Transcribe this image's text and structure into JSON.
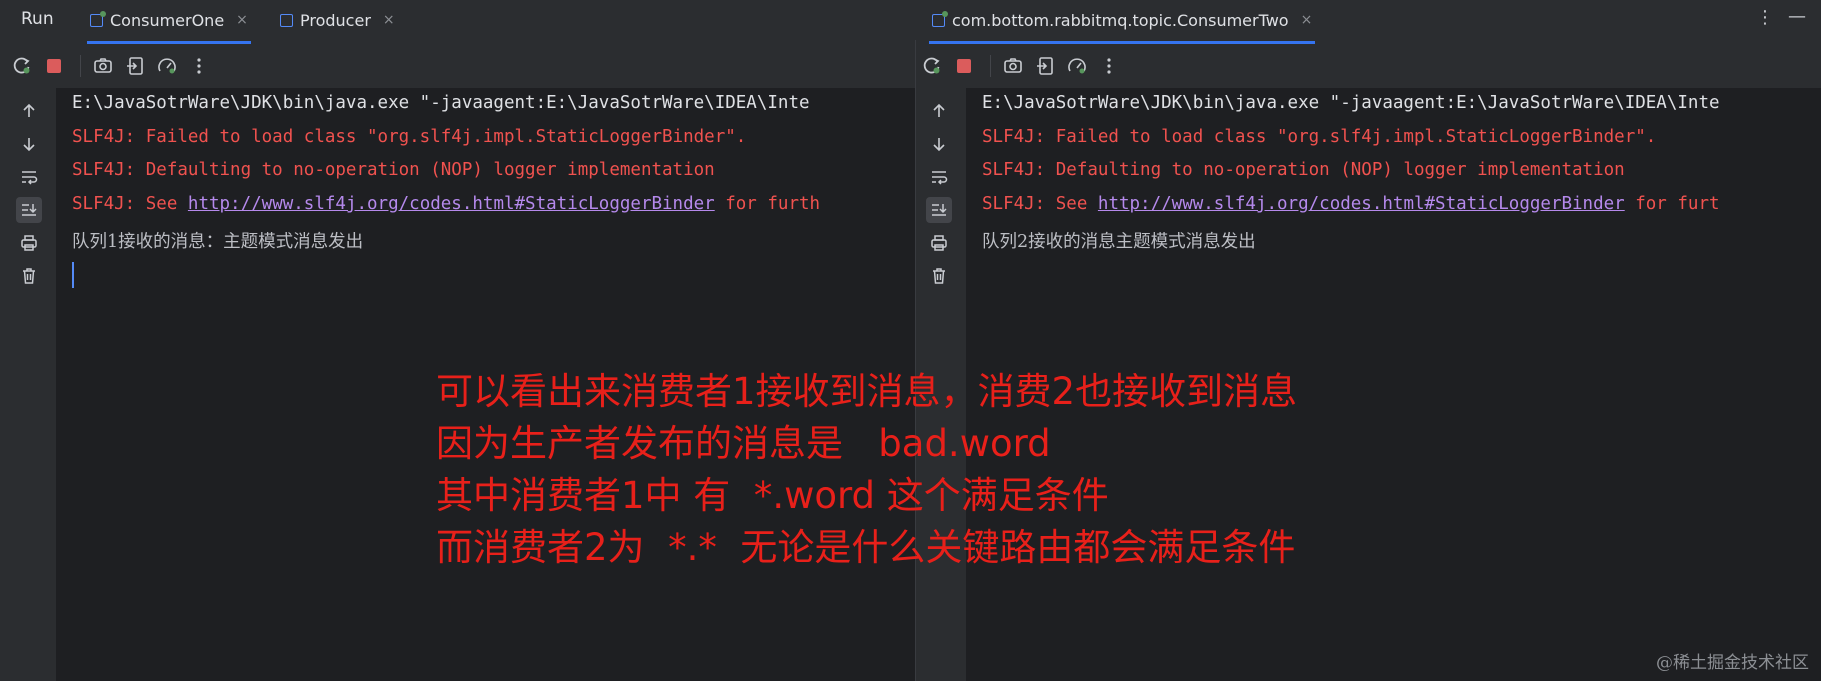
{
  "header": {
    "run_label": "Run",
    "tabs": [
      {
        "label": "ConsumerOne",
        "close": "×"
      },
      {
        "label": "Producer",
        "close": "×"
      },
      {
        "label": "com.bottom.rabbitmq.topic.ConsumerTwo",
        "close": "×"
      }
    ],
    "more": "⋮",
    "minimize": "—"
  },
  "toolbar_icons": [
    "rerun-icon",
    "stop-icon",
    "screenshot-icon",
    "exit-icon",
    "profiler-icon",
    "more-icon"
  ],
  "gutter_icons": [
    "scroll-up-icon",
    "scroll-down-icon",
    "soft-wrap-icon",
    "scroll-to-end-icon",
    "print-icon",
    "clear-icon"
  ],
  "colors": {
    "error_text": "#f0524f",
    "link": "#b589ec",
    "accent": "#3574f0",
    "annotation": "#e8201a"
  },
  "consoles": [
    {
      "cmd": "E:\\JavaSotrWare\\JDK\\bin\\java.exe \"-javaagent:E:\\JavaSotrWare\\IDEA\\Inte",
      "err1": "SLF4J: Failed to load class \"org.slf4j.impl.StaticLoggerBinder\".",
      "err2": "SLF4J: Defaulting to no-operation (NOP) logger implementation",
      "err3_prefix": "SLF4J: See ",
      "err3_link": "http://www.slf4j.org/codes.html#StaticLoggerBinder",
      "err3_suffix": " for furth",
      "output": "队列1接收的消息：主题模式消息发出"
    },
    {
      "cmd": "E:\\JavaSotrWare\\JDK\\bin\\java.exe \"-javaagent:E:\\JavaSotrWare\\IDEA\\Inte",
      "err1": "SLF4J: Failed to load class \"org.slf4j.impl.StaticLoggerBinder\".",
      "err2": "SLF4J: Defaulting to no-operation (NOP) logger implementation",
      "err3_prefix": "SLF4J: See ",
      "err3_link": "http://www.slf4j.org/codes.html#StaticLoggerBinder",
      "err3_suffix": " for furt",
      "output": "队列2接收的消息主题模式消息发出"
    }
  ],
  "annotation": [
    "可以看出来消费者1接收到消息，消费2也接收到消息",
    "因为生产者发布的消息是   bad.word",
    "其中消费者1中 有  *.word 这个满足条件",
    "而消费者2为  *.*  无论是什么关键路由都会满足条件"
  ],
  "watermark": "@稀土掘金技术社区"
}
